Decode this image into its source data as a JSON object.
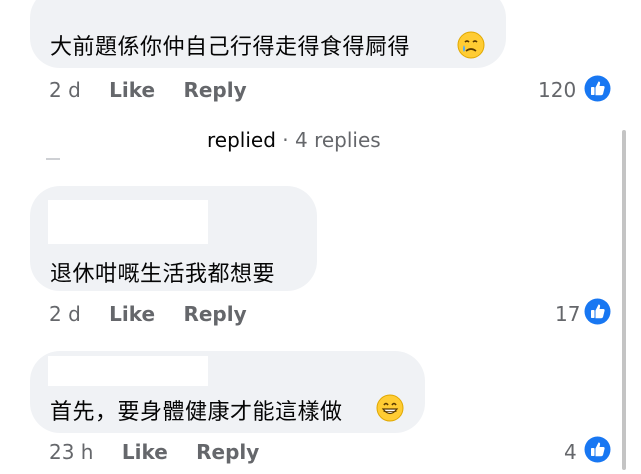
{
  "comments": [
    {
      "text": "大前題係你仲自己行得走得食得屙得",
      "emoji": "crying-face-emoji",
      "time": "2 d",
      "like_label": "Like",
      "reply_label": "Reply",
      "reaction_count": "120"
    },
    {
      "text": "退休咁嘅生活我都想要",
      "time": "2 d",
      "like_label": "Like",
      "reply_label": "Reply",
      "reaction_count": "17"
    },
    {
      "text": "首先，要身體健康才能這樣做",
      "emoji": "grinning-face-emoji",
      "time": "23 h",
      "like_label": "Like",
      "reply_label": "Reply",
      "reaction_count": "4"
    }
  ],
  "replies_link": {
    "label": "replied",
    "separator": "·",
    "count": "4 replies"
  },
  "colors": {
    "bubble": "#f0f2f5",
    "meta_text": "#65676b",
    "like_blue": "#1877f2"
  }
}
